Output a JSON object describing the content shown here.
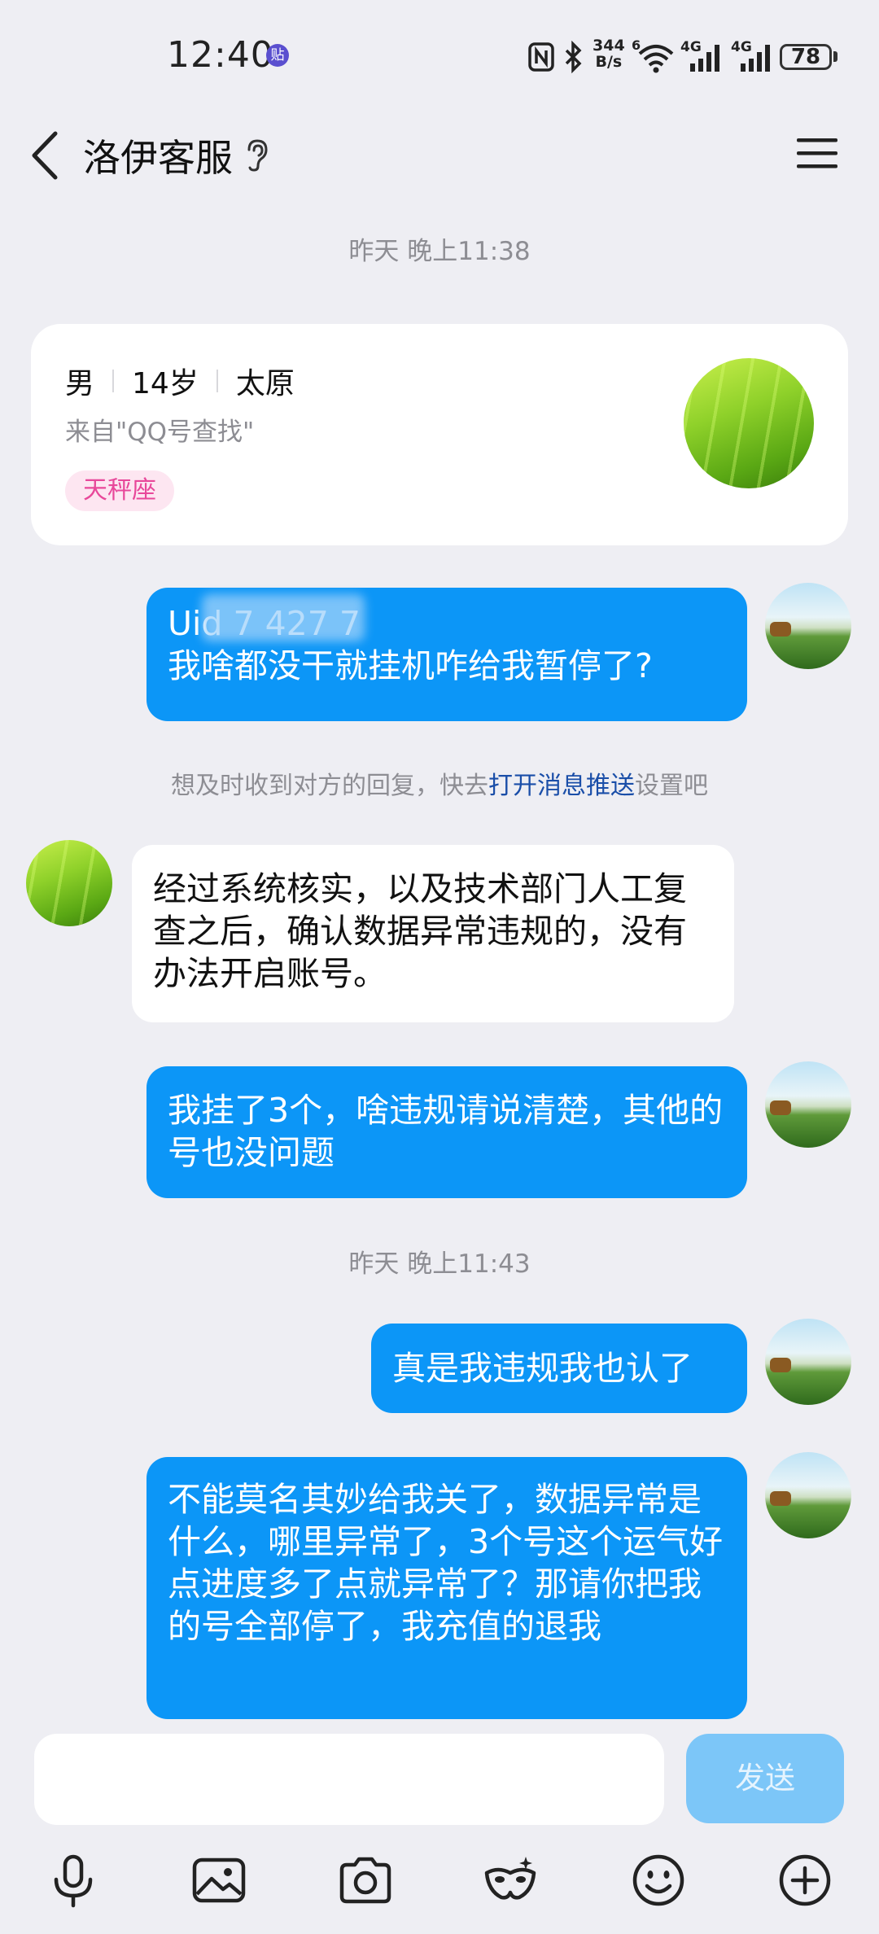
{
  "status_bar": {
    "time": "12:40",
    "app_badge": "贴",
    "net_speed_value": "344",
    "net_speed_unit": "B/s",
    "sim1": "4G",
    "sim2": "4G",
    "wifi_sup": "6",
    "battery": "78",
    "icons": [
      "nfc-icon",
      "bluetooth-icon",
      "wifi-icon",
      "signal-icon",
      "signal-icon",
      "battery-icon"
    ]
  },
  "header": {
    "title": "洛伊客服",
    "icons": [
      "back-arrow-icon",
      "ear-icon",
      "menu-icon"
    ]
  },
  "chat": {
    "timestamp_1": "昨天 晚上11:38",
    "profile": {
      "gender": "男",
      "age": "14岁",
      "city": "太原",
      "source": "来自\"QQ号查找\"",
      "zodiac": "天秤座"
    },
    "msg_1_line1": "Uid 7 427 7",
    "msg_1_line2": "我啥都没干就挂机咋给我暂停了?",
    "notice_prefix": "想及时收到对方的回复，快去",
    "notice_link": "打开消息推送",
    "notice_suffix": "设置吧",
    "msg_2": "经过系统核实，以及技术部门人工复查之后，确认数据异常违规的，没有办法开启账号。",
    "msg_3": "我挂了3个，啥违规请说清楚，其他的号也没问题",
    "timestamp_2": "昨天 晚上11:43",
    "msg_4": "真是我违规我也认了",
    "msg_5": "不能莫名其妙给我关了，数据异常是什么，哪里异常了，3个号这个运气好点进度多了点就异常了？那请你把我的号全部停了，我充值的退我"
  },
  "input": {
    "placeholder": "",
    "send_label": "发送",
    "toolbar_icons": [
      "microphone-icon",
      "image-icon",
      "camera-icon",
      "mask-icon",
      "emoji-icon",
      "plus-icon"
    ]
  },
  "colors": {
    "my_bubble": "#0c96f7",
    "background": "#eeeef3",
    "link": "#1a4ea8",
    "send_disabled": "#7cc6f8",
    "zodiac_tag_bg": "#fde6f1",
    "zodiac_tag_text": "#e8489a"
  }
}
